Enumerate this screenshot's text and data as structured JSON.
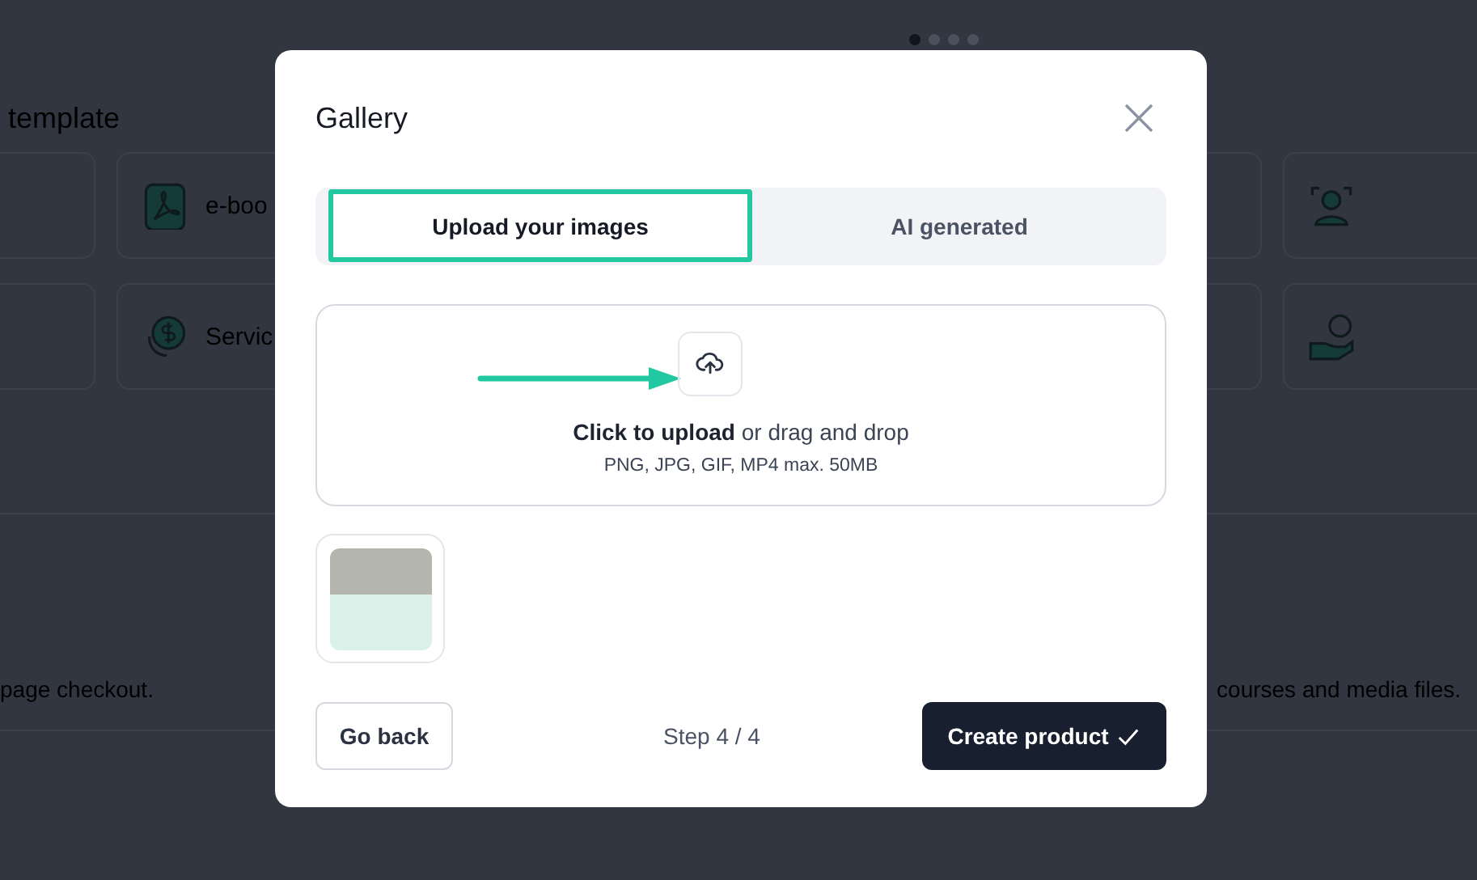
{
  "background": {
    "carousel_dots": [
      {
        "selected": true
      },
      {
        "selected": false
      },
      {
        "selected": false
      },
      {
        "selected": false
      }
    ],
    "heading": "template",
    "card_rows": [
      [
        {
          "kind": "blank"
        },
        {
          "kind": "pdf",
          "label": "e-boo"
        },
        {
          "kind": "blank"
        },
        {
          "kind": "person"
        }
      ],
      [
        {
          "kind": "blank"
        },
        {
          "kind": "coin",
          "label": "Servic"
        },
        {
          "kind": "blank"
        },
        {
          "kind": "hand-coin"
        }
      ]
    ],
    "descriptions": [
      "page checkout.",
      "courses and media files."
    ]
  },
  "dialog": {
    "title": "Gallery",
    "tabs": [
      {
        "label": "Upload your images",
        "selected": true,
        "highlighted": true
      },
      {
        "label": "AI generated",
        "selected": false,
        "highlighted": false
      }
    ],
    "dropzone": {
      "pointer_arrow": true,
      "instruction": "**Click to upload** or drag and drop",
      "formats": "PNG, JPG, GIF, MP4 max. 50MB"
    },
    "thumbnails": [
      {
        "kind": "image"
      }
    ],
    "back_button": "Go back",
    "step": "Step 4 / 4",
    "create_button": "Create product"
  }
}
